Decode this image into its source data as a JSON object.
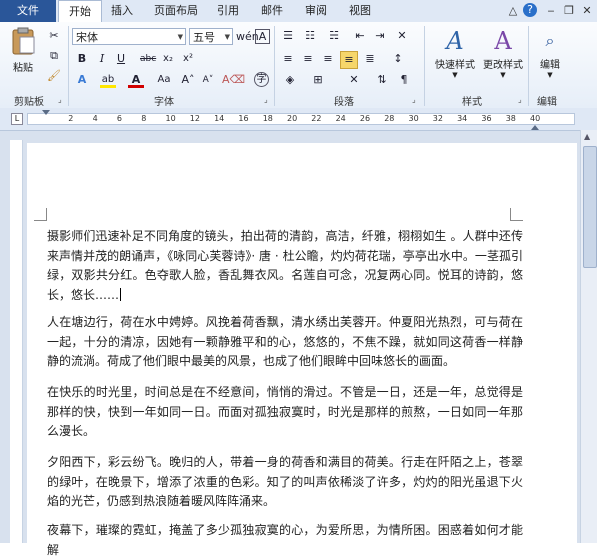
{
  "tabs": {
    "file": "文件",
    "home": "开始",
    "insert": "插入",
    "page_layout": "页面布局",
    "references": "引用",
    "mailings": "邮件",
    "review": "审阅",
    "view": "视图"
  },
  "ribbon": {
    "paste": "粘贴",
    "font_name": "宋体",
    "font_size": "五号",
    "group_clipboard": "剪贴板",
    "group_font": "字体",
    "group_paragraph": "段落",
    "group_styles": "样式",
    "group_editing": "编辑",
    "quick_styles": "快速样式",
    "change_styles": "更改样式",
    "editing": "编辑"
  },
  "ruler": {
    "ticks": [
      "2",
      "4",
      "6",
      "8",
      "10",
      "12",
      "14",
      "16",
      "18",
      "20",
      "22",
      "24",
      "26",
      "28",
      "30",
      "32",
      "34",
      "36",
      "38",
      "40"
    ]
  },
  "document": {
    "paragraphs": [
      "摄影师们迅速补足不同角度的镜头，拍出荷的清韵，高洁，纤雅，栩栩如生 。人群中还传来声情并茂的朗诵声，《咏同心芙蓉诗》· 唐 · 杜公瞻，灼灼荷花瑞，亭亭出水中。一茎孤引绿，双影共分红。色夺歌人脸，香乱舞衣风。名莲自可念，况复两心同。悦耳的诗韵，悠长，悠长……",
      "人在塘边行，荷在水中娉婷。风挽着荷香飘，清水绣出芙蓉开。仲夏阳光热烈，可与荷在一起，十分的清凉，因她有一颗静雅平和的心，悠悠的，不焦不躁，就如同这荷香一样静静的流淌。荷成了他们眼中最美的风景，也成了他们眼眸中回味悠长的画面。",
      "在快乐的时光里，时间总是在不经意间，悄悄的滑过。不管是一日，还是一年，总觉得是那样的快，快到一年如同一日。而面对孤独寂寞时，时光是那样的煎熬，一日如同一年那么漫长。",
      "夕阳西下，彩云纷飞。晚归的人，带着一身的荷香和满目的荷美。行走在阡陌之上，苍翠的绿叶，在晚景下，增添了浓重的色彩。知了的叫声依稀淡了许多，灼灼的阳光虽退下火焰的光芒，仍感到热浪随着暖风阵阵涌来。",
      "夜幕下，璀璨的霓虹，掩盖了多少孤独寂寞的心，为爱所思，为情所困。困惑着如何才能解"
    ]
  },
  "colors": {
    "file_tab": "#2a5699",
    "ribbon_bg": "#e6eef8",
    "workspace": "#d8e1ee",
    "highlight": "#ffe600",
    "font_color": "#d10000"
  }
}
